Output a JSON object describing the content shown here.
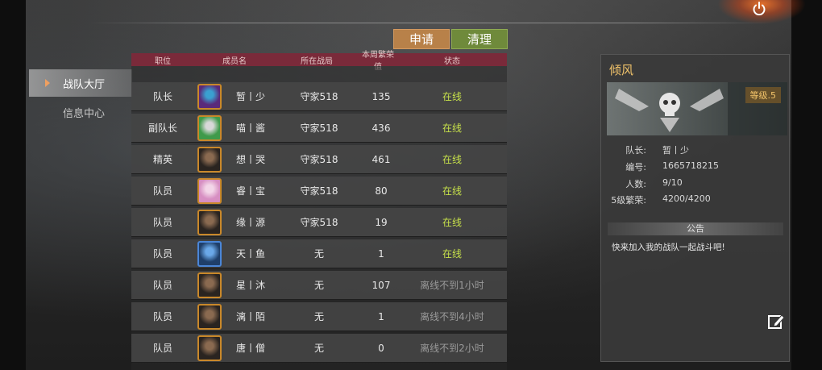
{
  "menu": {
    "items": [
      {
        "label": "战队大厅",
        "active": true
      },
      {
        "label": "信息中心",
        "active": false
      }
    ]
  },
  "actions": {
    "apply_label": "申请",
    "clean_label": "清理"
  },
  "table": {
    "headers": [
      "职位",
      "成员名",
      "所在战局",
      "本周繁荣值",
      "状态"
    ],
    "rows": [
      {
        "position": "队长",
        "name": "暂丨少",
        "server": "守家518",
        "value": "135",
        "status": "在线",
        "online": true,
        "avatar": "purple"
      },
      {
        "position": "副队长",
        "name": "喵丨酱",
        "server": "守家518",
        "value": "436",
        "status": "在线",
        "online": true,
        "avatar": "green"
      },
      {
        "position": "精英",
        "name": "想丨哭",
        "server": "守家518",
        "value": "461",
        "status": "在线",
        "online": true,
        "avatar": "dark"
      },
      {
        "position": "队员",
        "name": "睿丨宝",
        "server": "守家518",
        "value": "80",
        "status": "在线",
        "online": true,
        "avatar": "pink"
      },
      {
        "position": "队员",
        "name": "缘丨源",
        "server": "守家518",
        "value": "19",
        "status": "在线",
        "online": true,
        "avatar": "dark"
      },
      {
        "position": "队员",
        "name": "天丨鱼",
        "server": "无",
        "value": "1",
        "status": "在线",
        "online": true,
        "avatar": "blue"
      },
      {
        "position": "队员",
        "name": "星丨沐",
        "server": "无",
        "value": "107",
        "status": "离线不到1小时",
        "online": false,
        "avatar": "dark"
      },
      {
        "position": "队员",
        "name": "漓丨陌",
        "server": "无",
        "value": "1",
        "status": "离线不到4小时",
        "online": false,
        "avatar": "dark"
      },
      {
        "position": "队员",
        "name": "唐丨僧",
        "server": "无",
        "value": "0",
        "status": "离线不到2小时",
        "online": false,
        "avatar": "dark"
      }
    ]
  },
  "team": {
    "name": "倾风",
    "level": "等级.5",
    "captain_label": "队长:",
    "captain": "暂丨少",
    "id_label": "编号:",
    "id": "1665718215",
    "count_label": "人数:",
    "count": "9/10",
    "prosperity_label": "5级繁荣:",
    "prosperity": "4200/4200",
    "notice_title": "公告",
    "notice": "快来加入我的战队一起战斗吧!"
  },
  "colors": {
    "online": "#c6e04a",
    "offline": "#9a9a9a",
    "team_name": "#f1c36a",
    "apply_btn": "#b88149",
    "clean_btn": "#6f8a3b",
    "header": "#7a2a3a"
  },
  "icons": {
    "power": "power-icon",
    "edit": "edit-icon",
    "menu_arrow": "arrow-right-icon"
  }
}
